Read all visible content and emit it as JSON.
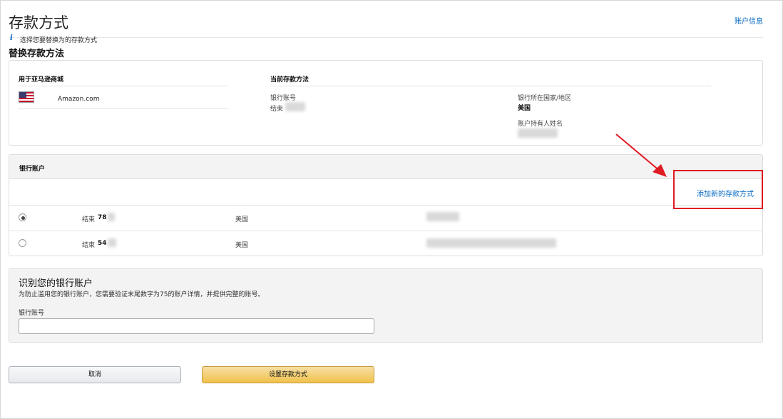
{
  "page": {
    "title": "存款方式",
    "account_info_link": "账户信息",
    "section_title": "替换存款方法"
  },
  "current_method": {
    "marketplace_header": "用于亚马逊商城",
    "marketplace_name": "Amazon.com",
    "current_header": "当前存款方法",
    "bank_account_label": "银行账号",
    "ending_label": "结束",
    "bank_country_label": "银行所在国家/地区",
    "bank_country_value": "美国",
    "holder_label": "账户持有人姓名"
  },
  "bank_accounts": {
    "header": "银行账户",
    "info_icon": "i",
    "info_text": "选择您要替换为的存款方式",
    "add_new_link": "添加新的存款方式",
    "rows": [
      {
        "ending_label": "结束",
        "ending_digits": "78",
        "country": "美国",
        "selected": true
      },
      {
        "ending_label": "结束",
        "ending_digits": "54",
        "country": "美国",
        "selected": false
      }
    ]
  },
  "verify": {
    "title": "识别您的银行账户",
    "description": "为防止滥用您的银行账户，您需要验证末尾数字为75的账户详情，并提供完整的账号。",
    "field_label": "银行账号",
    "field_value": ""
  },
  "buttons": {
    "cancel": "取消",
    "set_method": "设置存款方式"
  },
  "colors": {
    "link": "#0066c0",
    "annotation_red": "#e01b22",
    "primary_button": "#f0c14b"
  }
}
